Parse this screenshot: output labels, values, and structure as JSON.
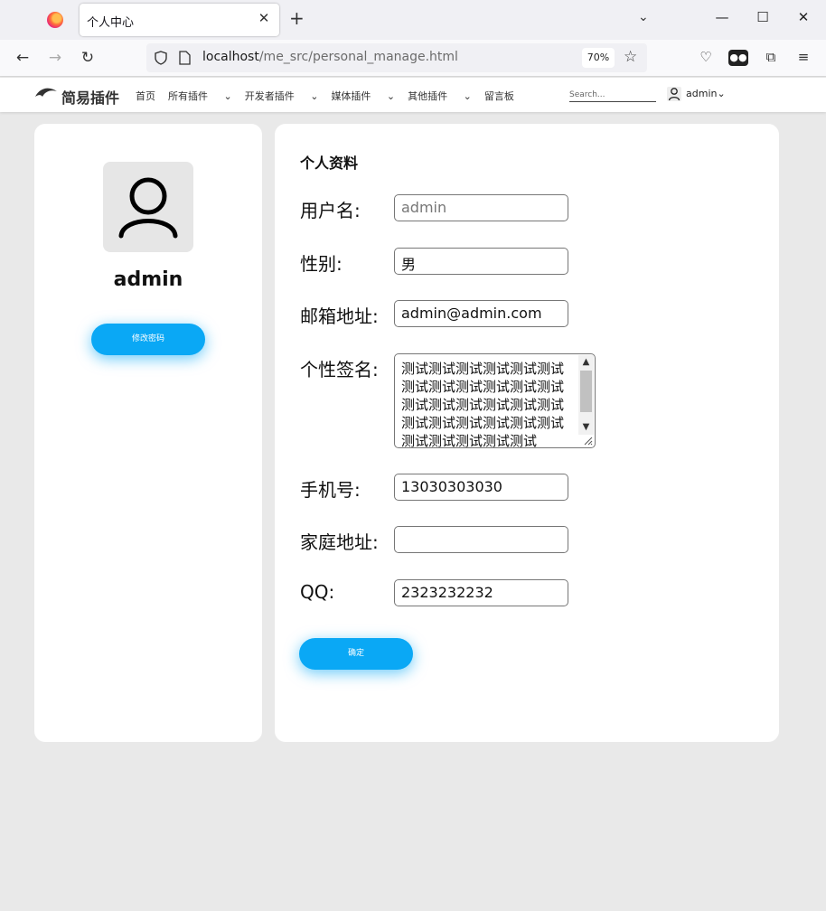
{
  "browser": {
    "tab_title": "个人中心",
    "url_host": "localhost",
    "url_path": "/me_src/personal_manage.html",
    "zoom": "70%"
  },
  "site": {
    "logo_text": "简易插件",
    "nav": [
      "首页",
      "所有插件",
      "开发者插件",
      "媒体插件",
      "其他插件",
      "留言板"
    ],
    "search_placeholder": "Search...",
    "user": "admin"
  },
  "profile": {
    "username": "admin",
    "change_password_label": "修改密码"
  },
  "form": {
    "title": "个人资料",
    "labels": {
      "username": "用户名:",
      "gender": "性别:",
      "email": "邮箱地址:",
      "signature": "个性签名:",
      "phone": "手机号:",
      "address": "家庭地址:",
      "qq": "QQ:"
    },
    "values": {
      "username_placeholder": "admin",
      "gender": "男",
      "email": "admin@admin.com",
      "signature": "测试测试测试测试测试测试测试测试测试测试测试测试测试测试测试测试测试测试测试测试测试测试测试测试测试测试测试测试测试",
      "phone": "13030303030",
      "address": "",
      "qq": "2323232232"
    },
    "submit_label": "确定"
  },
  "colors": {
    "accent": "#0aa8f5",
    "page_bg": "#e9e9e9"
  }
}
